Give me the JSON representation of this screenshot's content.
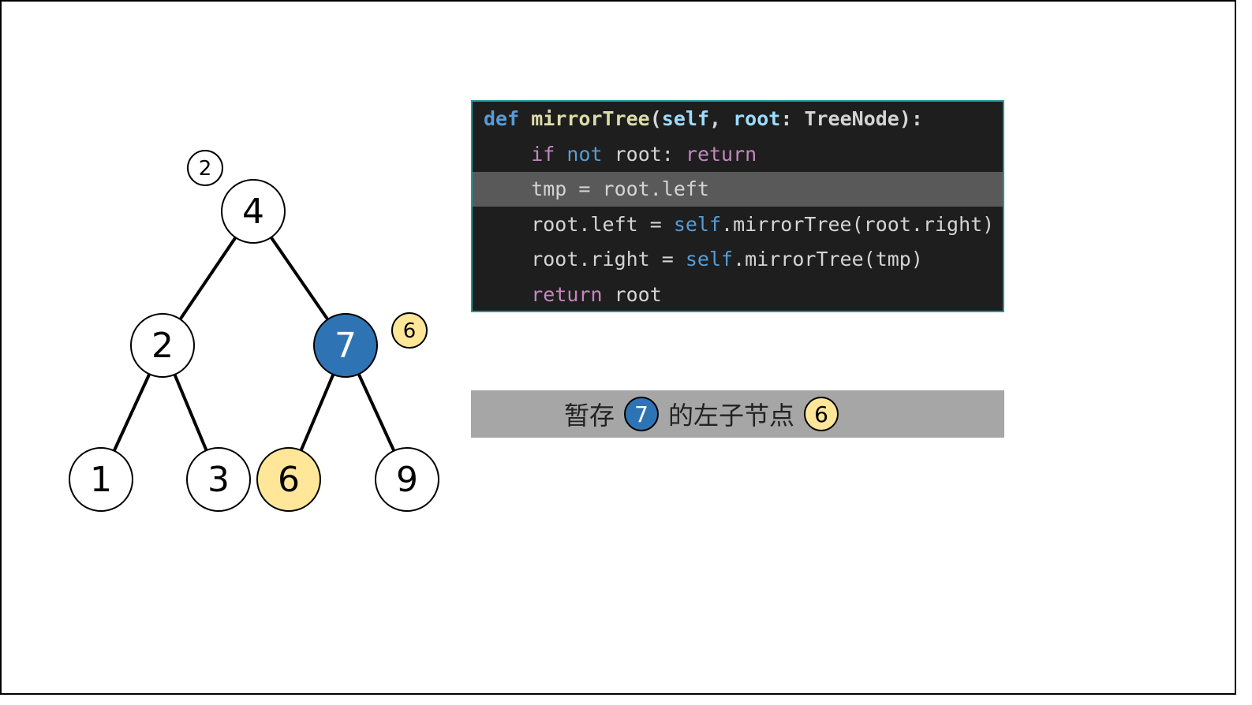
{
  "colors": {
    "node_fill": "#ffffff",
    "active_node": "#2e74b5",
    "temp_node": "#ffe699",
    "code_bg": "#1e1e1e",
    "code_border": "#1e9a9a",
    "highlight_row": "#595959",
    "caption_bg": "#a6a6a6"
  },
  "tree": {
    "nodes": [
      {
        "id": "n4",
        "label": "4",
        "state": "normal"
      },
      {
        "id": "n2",
        "label": "2",
        "state": "normal"
      },
      {
        "id": "n7",
        "label": "7",
        "state": "active"
      },
      {
        "id": "n1",
        "label": "1",
        "state": "normal"
      },
      {
        "id": "n3",
        "label": "3",
        "state": "normal"
      },
      {
        "id": "n6",
        "label": "6",
        "state": "temp"
      },
      {
        "id": "n9",
        "label": "9",
        "state": "normal"
      }
    ],
    "edges": [
      [
        "n4",
        "n2"
      ],
      [
        "n4",
        "n7"
      ],
      [
        "n2",
        "n1"
      ],
      [
        "n2",
        "n3"
      ],
      [
        "n7",
        "n6"
      ],
      [
        "n7",
        "n9"
      ]
    ],
    "badges": [
      {
        "id": "badge-root",
        "label": "2",
        "near": "n4",
        "state": "normal"
      },
      {
        "id": "badge-tmp",
        "label": "6",
        "near": "n7",
        "state": "temp"
      }
    ]
  },
  "code": {
    "highlighted_line": 2,
    "lines": [
      [
        {
          "t": "def",
          "c": "kw-blue bold"
        },
        {
          "t": " ",
          "c": ""
        },
        {
          "t": "mirrorTree",
          "c": "fn bold"
        },
        {
          "t": "(",
          "c": "bold"
        },
        {
          "t": "self",
          "c": "param bold"
        },
        {
          "t": ", ",
          "c": "bold"
        },
        {
          "t": "root",
          "c": "param bold"
        },
        {
          "t": ": TreeNode):",
          "c": "bold"
        }
      ],
      [
        {
          "t": "    ",
          "c": ""
        },
        {
          "t": "if",
          "c": "kw-purple"
        },
        {
          "t": " ",
          "c": ""
        },
        {
          "t": "not",
          "c": "kw-blue"
        },
        {
          "t": " root: ",
          "c": ""
        },
        {
          "t": "return",
          "c": "kw-purple"
        }
      ],
      [
        {
          "t": "    tmp = root.left",
          "c": ""
        }
      ],
      [
        {
          "t": "    root.left = ",
          "c": ""
        },
        {
          "t": "self",
          "c": "kw-blue"
        },
        {
          "t": ".mirrorTree(root.right)",
          "c": ""
        }
      ],
      [
        {
          "t": "    root.right = ",
          "c": ""
        },
        {
          "t": "self",
          "c": "kw-blue"
        },
        {
          "t": ".mirrorTree(tmp)",
          "c": ""
        }
      ],
      [
        {
          "t": "    ",
          "c": ""
        },
        {
          "t": "return",
          "c": "kw-purple"
        },
        {
          "t": " root",
          "c": ""
        }
      ]
    ]
  },
  "caption": {
    "prefix": "暂存",
    "node_label": "7",
    "middle": "的左子节点",
    "child_label": "6"
  }
}
